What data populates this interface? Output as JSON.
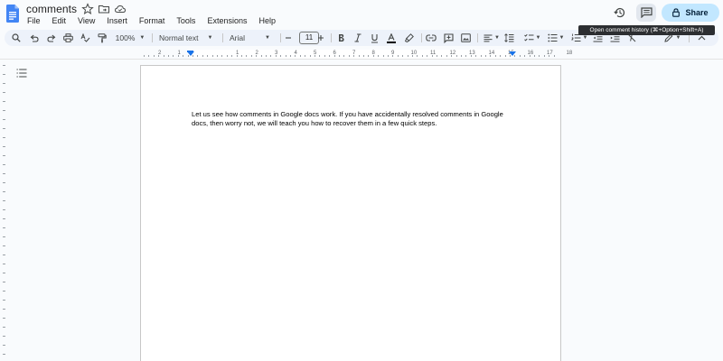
{
  "document": {
    "title": "comments",
    "body": "Let us see how comments in Google docs work. If you have accidentally resolved comments in Google docs, then worry not, we will teach you how to recover them in a few quick steps."
  },
  "menu": [
    "File",
    "Edit",
    "View",
    "Insert",
    "Format",
    "Tools",
    "Extensions",
    "Help"
  ],
  "header": {
    "share_label": "Share",
    "tooltip": "Open comment history (⌘+Option+Shift+A)"
  },
  "toolbar": {
    "zoom": "100%",
    "style": "Normal text",
    "font": "Arial",
    "font_size": "11"
  },
  "ruler": {
    "numbers": [
      "2",
      "1",
      "1",
      "2",
      "3",
      "4",
      "5",
      "6",
      "7",
      "8",
      "9",
      "10",
      "11",
      "12",
      "13",
      "14",
      "15",
      "16",
      "17",
      "18"
    ]
  },
  "colors": {
    "accent": "#1a73e8",
    "share_bg": "#c2e7ff",
    "toolbar_bg": "#edf2fa",
    "docs_blue": "#4285f4"
  },
  "icons": [
    "docs-logo-icon",
    "star-icon",
    "move-folder-icon",
    "cloud-saved-icon",
    "version-history-icon",
    "comment-history-icon",
    "lock-icon",
    "search-icon",
    "undo-icon",
    "redo-icon",
    "print-icon",
    "spellcheck-icon",
    "paint-format-icon",
    "bold-icon",
    "italic-icon",
    "underline-icon",
    "text-color-icon",
    "highlight-icon",
    "link-icon",
    "add-comment-icon",
    "insert-image-icon",
    "align-icon",
    "line-spacing-icon",
    "checklist-icon",
    "bulleted-list-icon",
    "numbered-list-icon",
    "decrease-indent-icon",
    "clear-formatting-icon",
    "edit-mode-icon",
    "collapse-icon",
    "outline-icon"
  ]
}
